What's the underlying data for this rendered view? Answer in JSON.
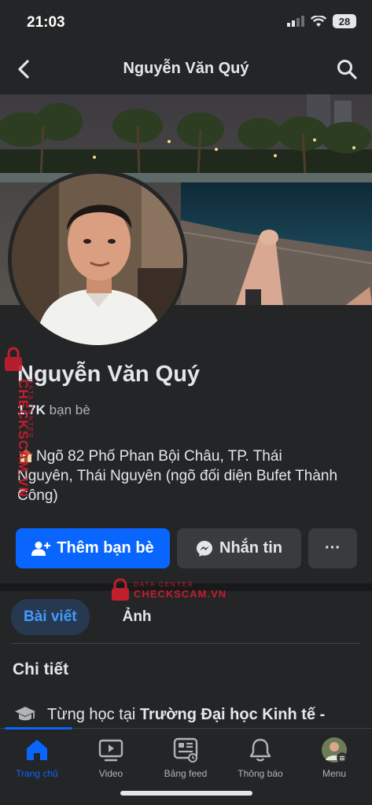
{
  "status_bar": {
    "time": "21:03",
    "battery": "28"
  },
  "header": {
    "title": "Nguyễn Văn Quý"
  },
  "profile": {
    "name": "Nguyễn Văn Quý",
    "friends_count": "1,7K",
    "friends_label": "bạn bè",
    "address": "Ngõ 82 Phố Phan Bội Châu, TP. Thái Nguyên, Thái Nguyên (ngõ đối diện Bufet Thành Công)"
  },
  "actions": {
    "add_friend": "Thêm bạn bè",
    "message": "Nhắn tin",
    "more": "···"
  },
  "tabs": [
    {
      "label": "Bài viết",
      "active": true
    },
    {
      "label": "Ảnh",
      "active": false
    }
  ],
  "details": {
    "title": "Chi tiết",
    "education_prefix": "Từng học tại",
    "education_school": "Trường Đại học Kinh tế -"
  },
  "bottom_nav": [
    {
      "label": "Trang chủ",
      "icon": "home-icon",
      "active": true
    },
    {
      "label": "Video",
      "icon": "video-icon",
      "active": false
    },
    {
      "label": "Bảng feed",
      "icon": "feed-icon",
      "active": false
    },
    {
      "label": "Thông báo",
      "icon": "bell-icon",
      "active": false
    },
    {
      "label": "Menu",
      "icon": "menu-avatar-icon",
      "active": false
    }
  ],
  "watermark": {
    "brand": "CHECKSCAM.VN",
    "tagline": "DATA CENTER"
  },
  "colors": {
    "accent": "#0866ff",
    "background": "#242526",
    "button_secondary": "#3a3b3c",
    "watermark": "#c21e2e"
  }
}
